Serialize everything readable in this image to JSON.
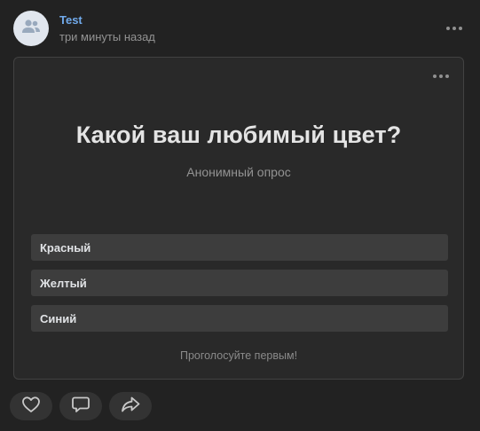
{
  "post": {
    "author": "Test",
    "time": "три минуты назад"
  },
  "poll": {
    "question": "Какой ваш любимый цвет?",
    "subtitle": "Анонимный опрос",
    "options": [
      {
        "label": "Красный"
      },
      {
        "label": "Желтый"
      },
      {
        "label": "Синий"
      }
    ],
    "footer": "Проголосуйте первым!"
  },
  "actions": [
    {
      "icon": "heart-icon"
    },
    {
      "icon": "comment-icon"
    },
    {
      "icon": "share-icon"
    }
  ],
  "colors": {
    "background": "#222222",
    "card": "#292929",
    "option": "#3d3d3d",
    "author_link": "#71aaeb",
    "muted_text": "#939393"
  }
}
